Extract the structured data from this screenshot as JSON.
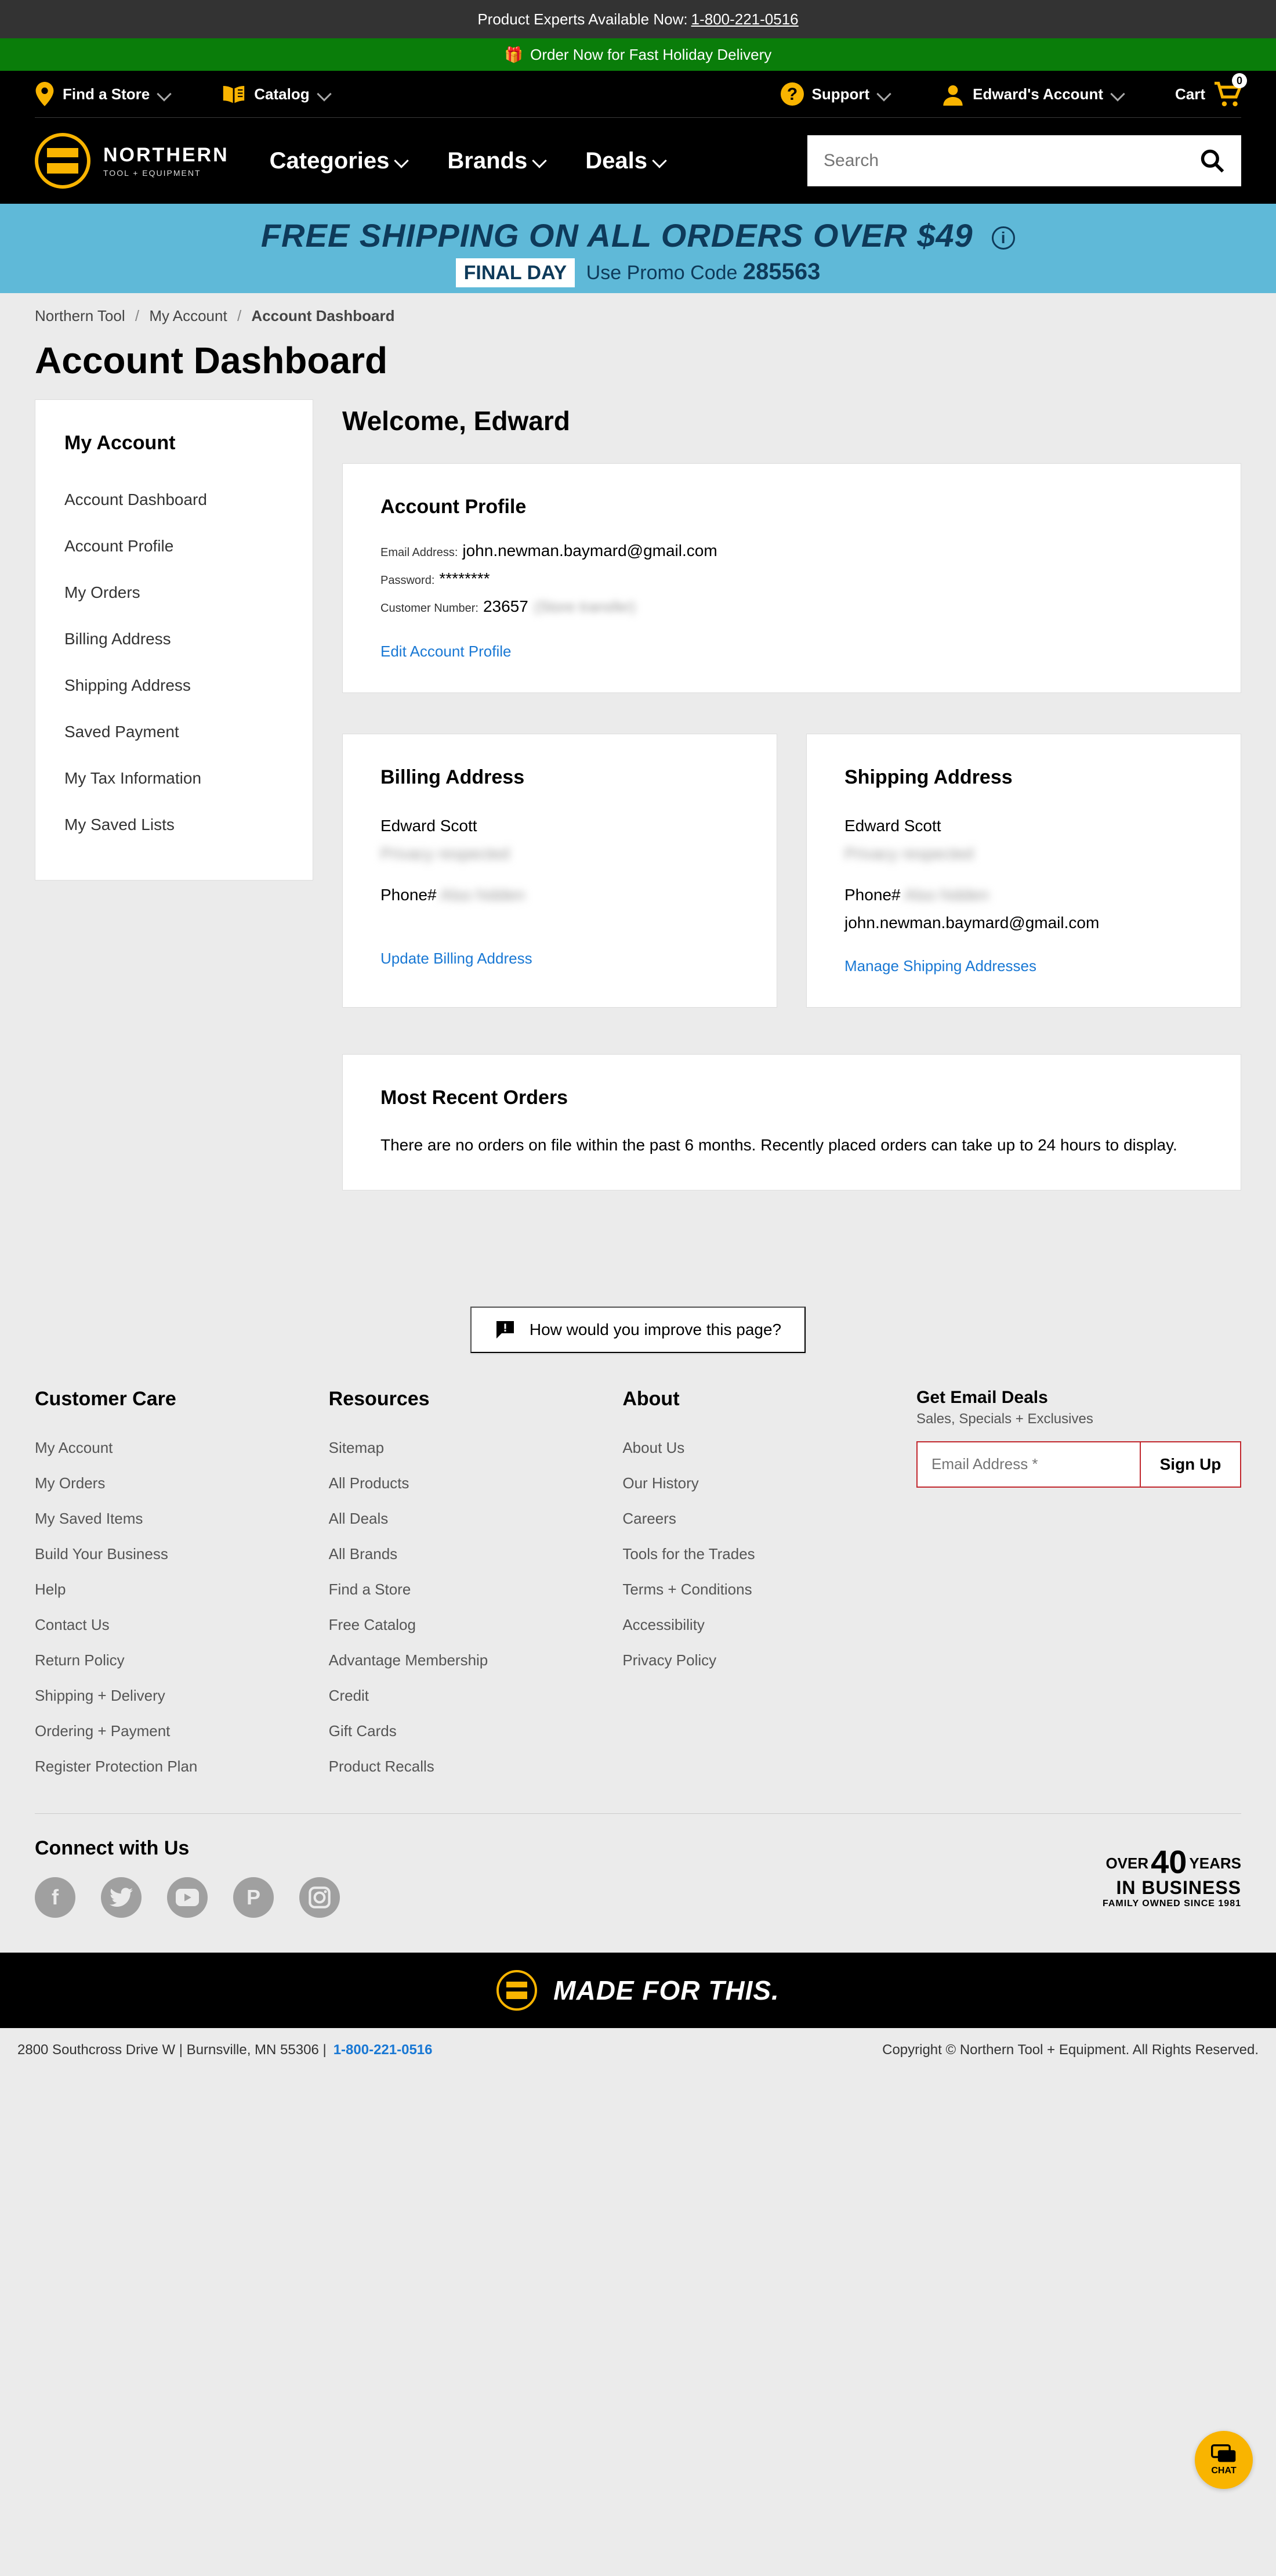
{
  "topbar": {
    "text": "Product Experts Available Now:",
    "phone": "1-800-221-0516"
  },
  "greenbar": {
    "text": "Order Now for Fast Holiday Delivery"
  },
  "util": {
    "find": "Find a Store",
    "catalog": "Catalog",
    "support": "Support",
    "account": "Edward's Account",
    "cart": "Cart",
    "cart_count": "0"
  },
  "logo": {
    "brand": "NORTHERN",
    "sub": "TOOL + EQUIPMENT"
  },
  "nav": {
    "categories": "Categories",
    "brands": "Brands",
    "deals": "Deals"
  },
  "search": {
    "placeholder": "Search"
  },
  "promo": {
    "line1a": "FREE SHIPPING",
    "line1b": " ON ALL ORDERS OVER $49",
    "final": "FINAL DAY",
    "use": "Use Promo Code ",
    "code": "285563"
  },
  "crumbs": {
    "a": "Northern Tool",
    "b": "My Account",
    "c": "Account Dashboard"
  },
  "title": "Account Dashboard",
  "sidebar": {
    "heading": "My Account",
    "items": [
      "Account Dashboard",
      "Account Profile",
      "My Orders",
      "Billing Address",
      "Shipping Address",
      "Saved Payment",
      "My Tax Information",
      "My Saved Lists"
    ]
  },
  "welcome": "Welcome, Edward",
  "profile": {
    "heading": "Account Profile",
    "email_lbl": "Email Address:",
    "email": "john.newman.baymard@gmail.com",
    "pw_lbl": "Password:",
    "pw": "********",
    "cust_lbl": "Customer Number:",
    "cust": "23657",
    "cust_blur": "(Store transfer)",
    "edit": "Edit Account Profile"
  },
  "billing": {
    "heading": "Billing Address",
    "name": "Edward Scott",
    "addr_blur": "Privacy respected",
    "phone_lbl": "Phone# ",
    "phone_blur": "Also hidden",
    "link": "Update Billing Address"
  },
  "shipping": {
    "heading": "Shipping Address",
    "name": "Edward Scott",
    "addr_blur": "Privacy respected",
    "phone_lbl": "Phone# ",
    "phone_blur": "Also hidden",
    "email": "john.newman.baymard@gmail.com",
    "link": "Manage Shipping Addresses"
  },
  "orders": {
    "heading": "Most Recent Orders",
    "text": "There are no orders on file within the past 6 months. Recently placed orders can take up to 24 hours to display."
  },
  "feedback": "How would you improve this page?",
  "footer": {
    "col1": {
      "h": "Customer Care",
      "items": [
        "My Account",
        "My Orders",
        "My Saved Items",
        "Build Your Business",
        "Help",
        "Contact Us",
        "Return Policy",
        "Shipping + Delivery",
        "Ordering + Payment",
        "Register Protection Plan"
      ]
    },
    "col2": {
      "h": "Resources",
      "items": [
        "Sitemap",
        "All Products",
        "All Deals",
        "All Brands",
        "Find a Store",
        "Free Catalog",
        "Advantage Membership",
        "Credit",
        "Gift Cards",
        "Product Recalls"
      ]
    },
    "col3": {
      "h": "About",
      "items": [
        "About Us",
        "Our History",
        "Careers",
        "Tools for the Trades",
        "Terms + Conditions",
        "Accessibility",
        "Privacy Policy"
      ]
    },
    "email": {
      "h": "Get Email Deals",
      "sub": "Sales, Specials + Exclusives",
      "placeholder": "Email Address *",
      "btn": "Sign Up"
    }
  },
  "connect": {
    "h": "Connect with Us"
  },
  "years": {
    "l1a": "OVER",
    "l1b": "40",
    "l1c": "YEARS",
    "l2": "IN BUSINESS",
    "l3": "FAMILY OWNED SINCE 1981"
  },
  "madefor": "MADE FOR THIS.",
  "lastline": {
    "addr": "2800 Southcross Drive W | Burnsville, MN 55306 |",
    "phone": "1-800-221-0516",
    "copy": "Copyright © Northern Tool + Equipment. All Rights Reserved."
  },
  "chat": "CHAT"
}
